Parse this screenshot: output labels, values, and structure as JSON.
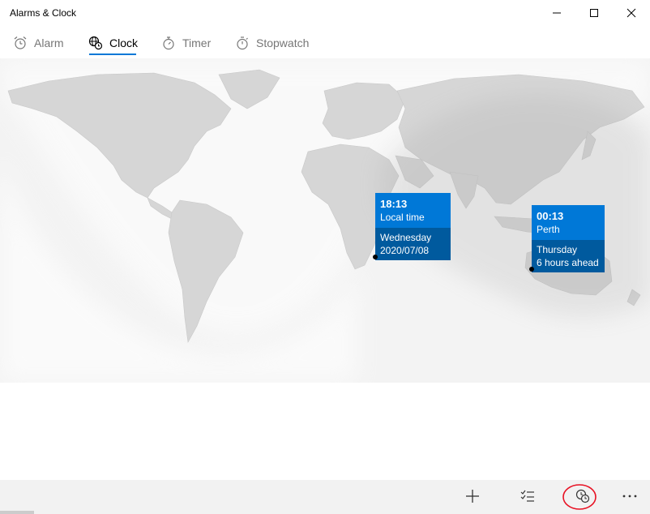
{
  "window": {
    "title": "Alarms & Clock",
    "controls": {
      "minimize": "minimize-icon",
      "maximize": "maximize-icon",
      "close": "close-icon"
    }
  },
  "tabs": [
    {
      "label": "Alarm",
      "icon": "alarm-icon",
      "active": false
    },
    {
      "label": "Clock",
      "icon": "world-clock-icon",
      "active": true
    },
    {
      "label": "Timer",
      "icon": "timer-icon",
      "active": false
    },
    {
      "label": "Stopwatch",
      "icon": "stopwatch-icon",
      "active": false
    }
  ],
  "clocks": [
    {
      "time": "18:13",
      "place": "Local time",
      "day": "Wednesday",
      "detail": "2020/07/08"
    },
    {
      "time": "00:13",
      "place": "Perth",
      "day": "Thursday",
      "detail": "6 hours ahead"
    }
  ],
  "colors": {
    "accent": "#0078d7",
    "accent_dark": "#005a9e",
    "map_land": "#d4d4d4",
    "map_bg": "#f3f3f3",
    "annotation": "#e81123"
  },
  "commandbar": {
    "items": [
      {
        "icon": "add-icon"
      },
      {
        "icon": "select-list-icon"
      },
      {
        "icon": "compare-clocks-icon",
        "annotated": true
      },
      {
        "icon": "more-icon"
      }
    ]
  }
}
